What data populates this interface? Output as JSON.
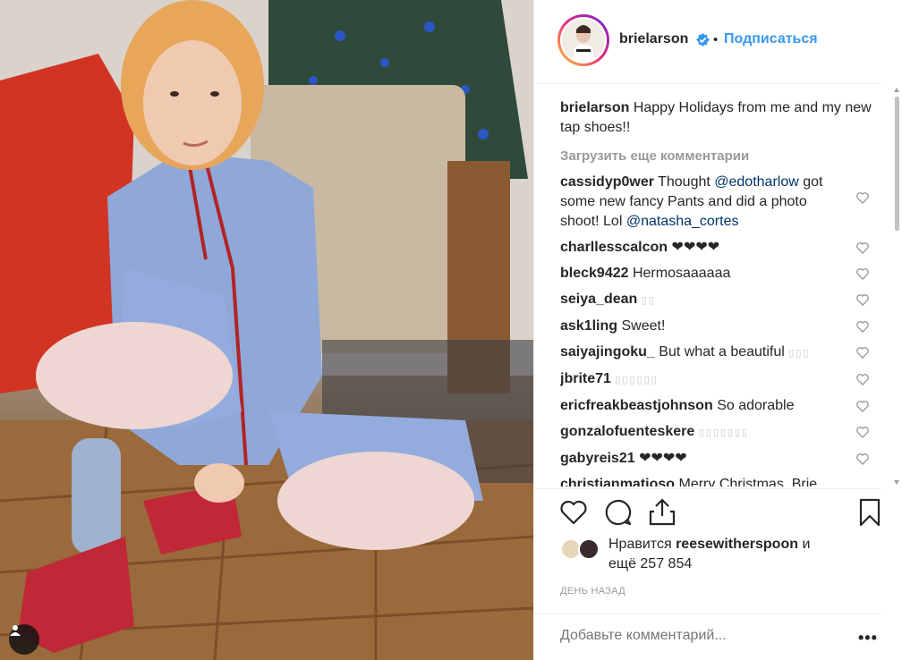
{
  "post": {
    "username": "brielarson",
    "follow_label": "Подписаться",
    "dot": "•",
    "caption_text": "Happy Holidays from me and my new tap shoes!!"
  },
  "load_more_label": "Загрузить еще комментарии",
  "comments": [
    {
      "user": "cassidyp0wer",
      "parts": [
        "Thought ",
        "@edotharlow",
        " got some new fancy Pants and did a photo shoot! Lol ",
        "@natasha_cortes"
      ]
    },
    {
      "user": "charllesscalcon",
      "text": "❤❤❤❤"
    },
    {
      "user": "bleck9422",
      "text": "Hermosaaaaaa"
    },
    {
      "user": "seiya_dean",
      "text": "▯▯"
    },
    {
      "user": "ask1ling",
      "text": "Sweet!"
    },
    {
      "user": "saiyajingoku_",
      "text": "But what a beautiful",
      "faint": "▯▯▯"
    },
    {
      "user": "jbrite71",
      "text": "▯▯▯▯▯▯"
    },
    {
      "user": "ericfreakbeastjohnson",
      "text": "So adorable"
    },
    {
      "user": "gonzalofuenteskere",
      "text": "▯▯▯▯▯▯▯"
    },
    {
      "user": "gabyreis21",
      "text": "❤❤❤❤"
    },
    {
      "user": "christianmatioso",
      "text": "Merry Christmas, Brie"
    }
  ],
  "likes": {
    "prefix": "Нравится",
    "user": "reesewitherspoon",
    "suffix": "и",
    "line2": "ещё 257 854"
  },
  "time_label": "ДЕНЬ НАЗАД",
  "add_comment_placeholder": "Добавьте комментарий...",
  "more_label": "•••",
  "colors": {
    "link": "#3897f0",
    "mention": "#003569",
    "verified": "#3897f0"
  }
}
